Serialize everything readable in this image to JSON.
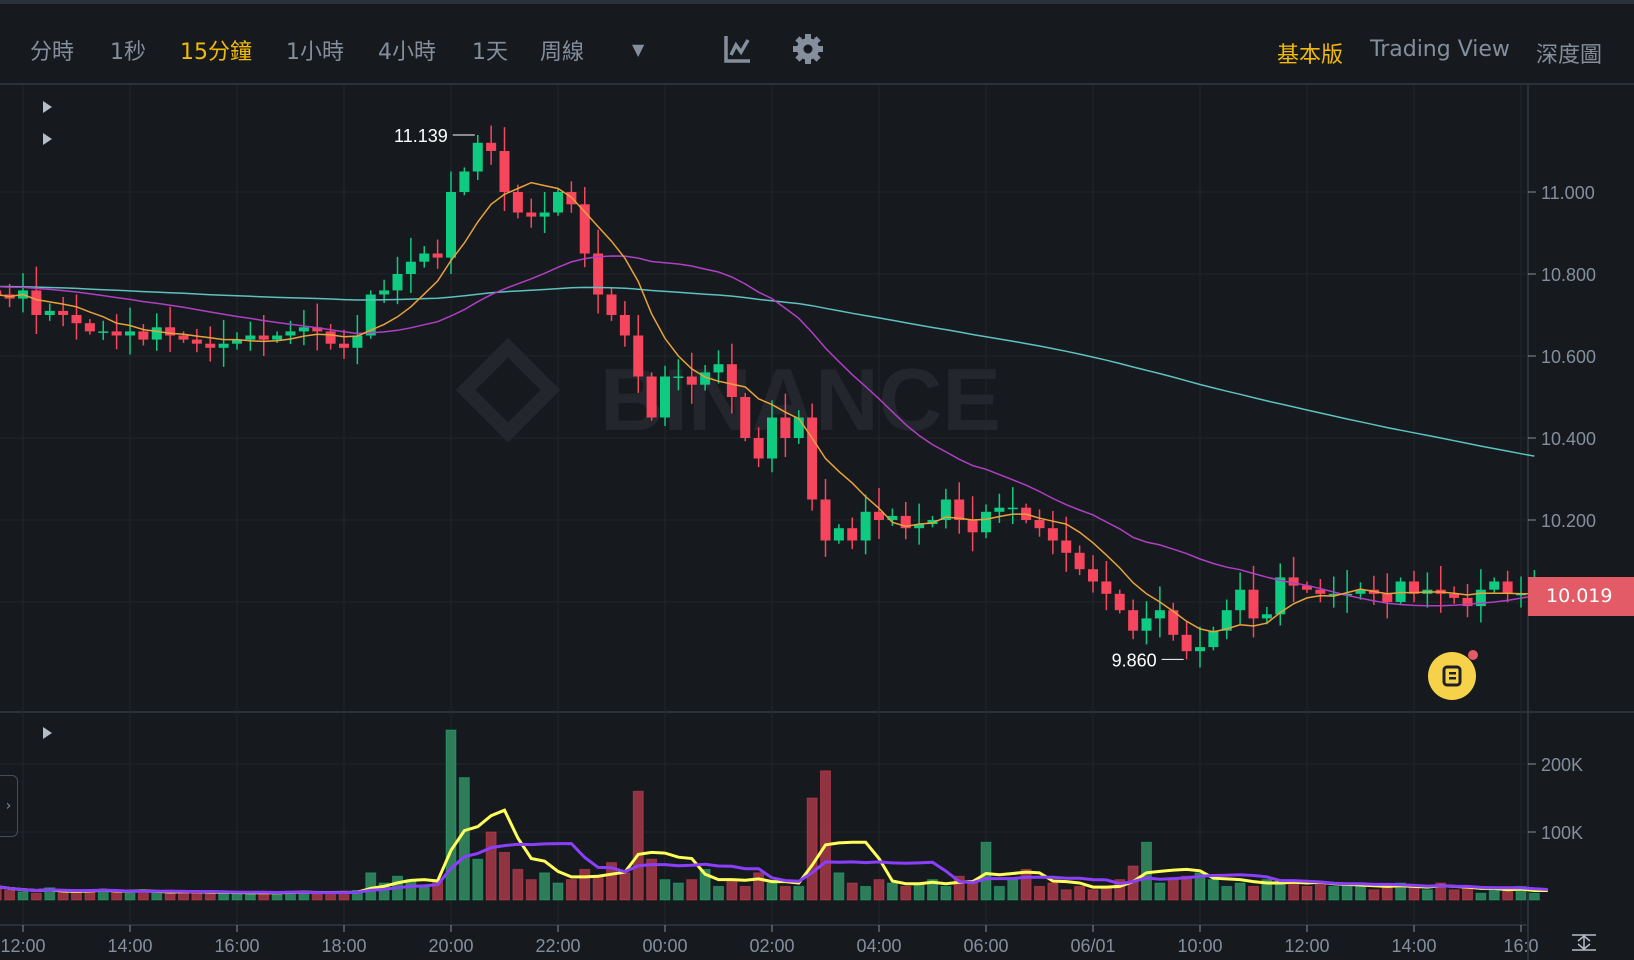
{
  "toolbar": {
    "intervals": [
      "分時",
      "1秒",
      "15分鐘",
      "1小時",
      "4小時",
      "1天",
      "周線"
    ],
    "active": "15分鐘",
    "views": [
      "基本版",
      "Trading View",
      "深度圖"
    ],
    "active_view": "基本版",
    "icons": [
      "dropdown-icon",
      "indicator-icon",
      "gear-icon"
    ]
  },
  "watermark": "BINANCE",
  "last_price": "10.019",
  "colors": {
    "up": "#0ecb81",
    "down": "#f6465d",
    "ma7": "#e9a23b",
    "ma25": "#b03fc4",
    "ma99": "#5ec1c1",
    "vma5": "#ffff5a",
    "vma10": "#8a3ffc",
    "accent": "#f0b90b"
  },
  "chart_data": {
    "type": "candlestick",
    "interval": "15m",
    "high_label": "11.139",
    "low_label": "9.860",
    "price_ticks": [
      "11.000",
      "10.800",
      "10.600",
      "10.400",
      "10.200"
    ],
    "price_tick_values": [
      11.0,
      10.8,
      10.6,
      10.4,
      10.2
    ],
    "volume_ticks": [
      "200K",
      "100K"
    ],
    "volume_tick_values": [
      200,
      100
    ],
    "time_ticks": [
      "12:00",
      "14:00",
      "16:00",
      "18:00",
      "20:00",
      "22:00",
      "00:00",
      "02:00",
      "04:00",
      "06:00",
      "06/01",
      "10:00",
      "12:00",
      "14:00",
      "16:0"
    ],
    "open_first": 10.76,
    "closes": [
      10.75,
      10.74,
      10.76,
      10.7,
      10.71,
      10.7,
      10.68,
      10.66,
      10.66,
      10.65,
      10.66,
      10.64,
      10.67,
      10.65,
      10.64,
      10.63,
      10.62,
      10.63,
      10.64,
      10.65,
      10.64,
      10.65,
      10.66,
      10.67,
      10.66,
      10.63,
      10.62,
      10.65,
      10.75,
      10.76,
      10.8,
      10.83,
      10.85,
      10.84,
      11.0,
      11.05,
      11.12,
      11.1,
      11.0,
      10.95,
      10.94,
      10.95,
      11.0,
      10.97,
      10.85,
      10.75,
      10.7,
      10.65,
      10.55,
      10.45,
      10.55,
      10.55,
      10.53,
      10.56,
      10.58,
      10.5,
      10.4,
      10.35,
      10.45,
      10.4,
      10.45,
      10.25,
      10.15,
      10.18,
      10.15,
      10.22,
      10.2,
      10.21,
      10.18,
      10.19,
      10.2,
      10.25,
      10.2,
      10.17,
      10.22,
      10.23,
      10.23,
      10.2,
      10.18,
      10.15,
      10.12,
      10.08,
      10.05,
      10.02,
      9.98,
      9.93,
      9.96,
      9.98,
      9.92,
      9.88,
      9.89,
      9.93,
      9.98,
      10.03,
      9.96,
      9.97,
      10.06,
      10.04,
      10.03,
      10.02,
      10.02,
      10.02,
      10.03,
      10.02,
      10.0,
      10.05,
      10.02,
      10.03,
      10.02,
      10.01,
      9.99,
      10.03,
      10.05,
      10.02,
      10.02,
      10.02
    ],
    "volumes": [
      20,
      14,
      12,
      10,
      18,
      12,
      11,
      15,
      16,
      12,
      10,
      14,
      11,
      12,
      13,
      10,
      12,
      11,
      9,
      12,
      10,
      11,
      13,
      12,
      9,
      10,
      12,
      14,
      40,
      25,
      35,
      30,
      20,
      30,
      250,
      180,
      60,
      100,
      70,
      45,
      30,
      40,
      25,
      30,
      45,
      35,
      55,
      40,
      160,
      60,
      30,
      25,
      30,
      45,
      20,
      30,
      20,
      40,
      25,
      20,
      20,
      150,
      190,
      40,
      25,
      20,
      30,
      25,
      20,
      25,
      30,
      20,
      35,
      25,
      85,
      20,
      30,
      45,
      20,
      25,
      15,
      20,
      15,
      20,
      30,
      50,
      85,
      25,
      30,
      35,
      40,
      30,
      20,
      25,
      20,
      30,
      30,
      25,
      20,
      25,
      20,
      25,
      20,
      15,
      20,
      25,
      20,
      15,
      25,
      15,
      20,
      10,
      15,
      15,
      20,
      10,
      10
    ]
  }
}
